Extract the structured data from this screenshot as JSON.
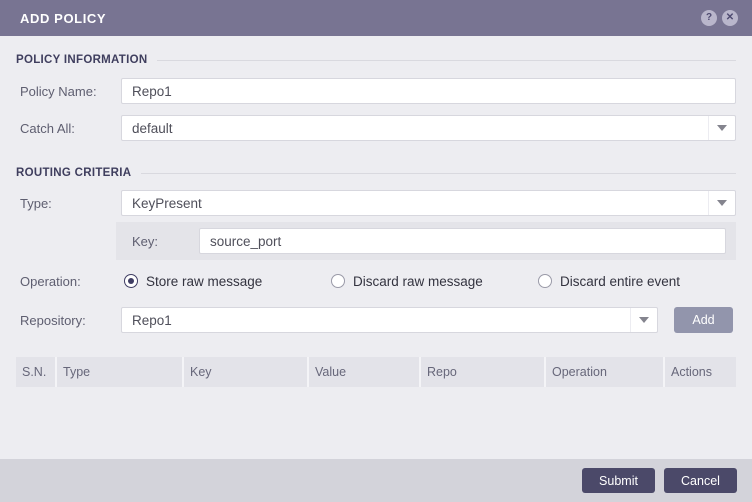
{
  "window": {
    "title": "ADD POLICY",
    "help_icon": "?",
    "close_icon": "✕"
  },
  "policy_information": {
    "section_title": "POLICY INFORMATION",
    "policy_name": {
      "label": "Policy Name:",
      "value": "Repo1"
    },
    "catch_all": {
      "label": "Catch All:",
      "value": "default"
    }
  },
  "routing_criteria": {
    "section_title": "ROUTING CRITERIA",
    "type": {
      "label": "Type:",
      "value": "KeyPresent"
    },
    "key": {
      "label": "Key:",
      "value": "source_port"
    },
    "operation": {
      "label": "Operation:",
      "options": [
        {
          "label": "Store raw message",
          "selected": true
        },
        {
          "label": "Discard raw message",
          "selected": false
        },
        {
          "label": "Discard entire event",
          "selected": false
        }
      ]
    },
    "repository": {
      "label": "Repository:",
      "value": "Repo1",
      "add_label": "Add"
    }
  },
  "criteria_table": {
    "columns": [
      "S.N.",
      "Type",
      "Key",
      "Value",
      "Repo",
      "Operation",
      "Actions"
    ],
    "rows": []
  },
  "footer": {
    "submit_label": "Submit",
    "cancel_label": "Cancel"
  },
  "colors": {
    "titlebar": "#787492",
    "body_bg": "#ededf1",
    "key_band_bg": "#e4e4e9",
    "footer_bg": "#d3d3da",
    "primary_button": "#4b4969",
    "add_button": "#9295ac",
    "section_title_text": "#3f3e5e",
    "table_header_bg": "#e3e3e9",
    "radio_selected": "#3f3d63"
  }
}
